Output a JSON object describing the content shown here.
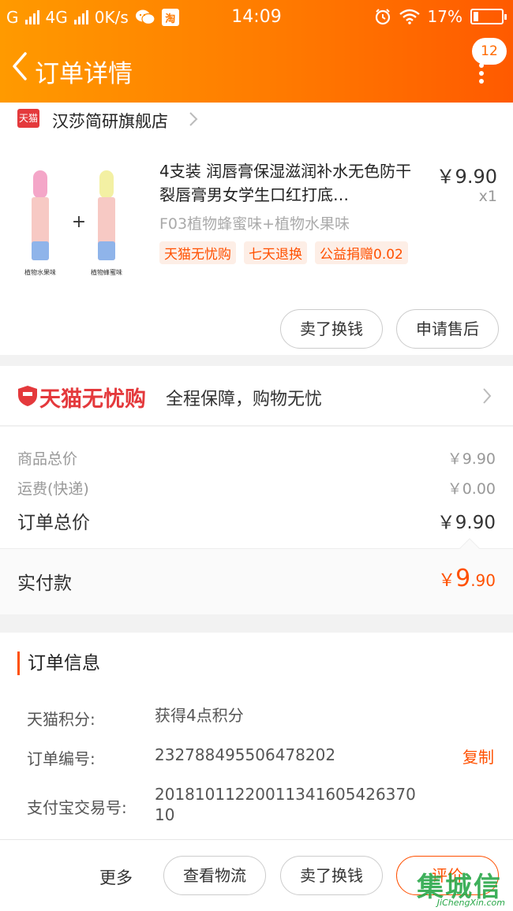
{
  "status_bar": {
    "carrier_signal": "G",
    "network": "4G",
    "speed": "0K/s",
    "taobao_icon": "淘",
    "time": "14:09",
    "battery": "17%"
  },
  "nav": {
    "title": "订单详情",
    "badge": "12"
  },
  "shop": {
    "logo_text": "天猫",
    "name": "汉莎简研旗舰店"
  },
  "product": {
    "title": "4支装 润唇膏保湿滋润补水无色防干裂唇膏男女学生口红打底…",
    "price": "￥9.90",
    "qty": "x1",
    "sku": "F03植物蜂蜜味+植物水果味",
    "tags": [
      "天猫无忧购",
      "七天退换",
      "公益捐赠0.02"
    ],
    "img_plus": "+",
    "img_label_left": "植物水果味",
    "img_label_right": "植物蜂蜜味",
    "actions": {
      "resell": "卖了换钱",
      "after_sale": "申请售后"
    }
  },
  "guarantee": {
    "brand": "天猫无忧购",
    "desc": "全程保障，购物无忧"
  },
  "prices": {
    "goods_label": "商品总价",
    "goods_value": "￥9.90",
    "shipping_label": "运费(快递)",
    "shipping_value": "￥0.00",
    "order_total_label": "订单总价",
    "order_total_value": "￥9.90",
    "paid_label": "实付款",
    "paid_currency": "￥",
    "paid_int": "9",
    "paid_dec": ".90"
  },
  "order_info": {
    "section_title": "订单信息",
    "points_label": "天猫积分:",
    "points_value": "获得4点积分",
    "order_no_label": "订单编号:",
    "order_no_value": "232788495506478202",
    "copy_label": "复制",
    "alipay_label": "支付宝交易号:",
    "alipay_value": "2018101122001134160542637010"
  },
  "bottom_bar": {
    "more": "更多",
    "logistics": "查看物流",
    "resell": "卖了换钱",
    "review": "评价"
  },
  "watermark": {
    "cn": "集城信",
    "en": "JiChengXin.com"
  },
  "colors": {
    "header_start": "#ff9a00",
    "header_end": "#ff5a00",
    "accent": "#ff5000",
    "tmall_red": "#e4393c"
  },
  "icons": [
    "signal-icon",
    "wechat-icon",
    "alarm-icon",
    "wifi-icon",
    "battery-icon",
    "back-icon",
    "more-icon",
    "chevron-right-icon",
    "shield-icon"
  ]
}
